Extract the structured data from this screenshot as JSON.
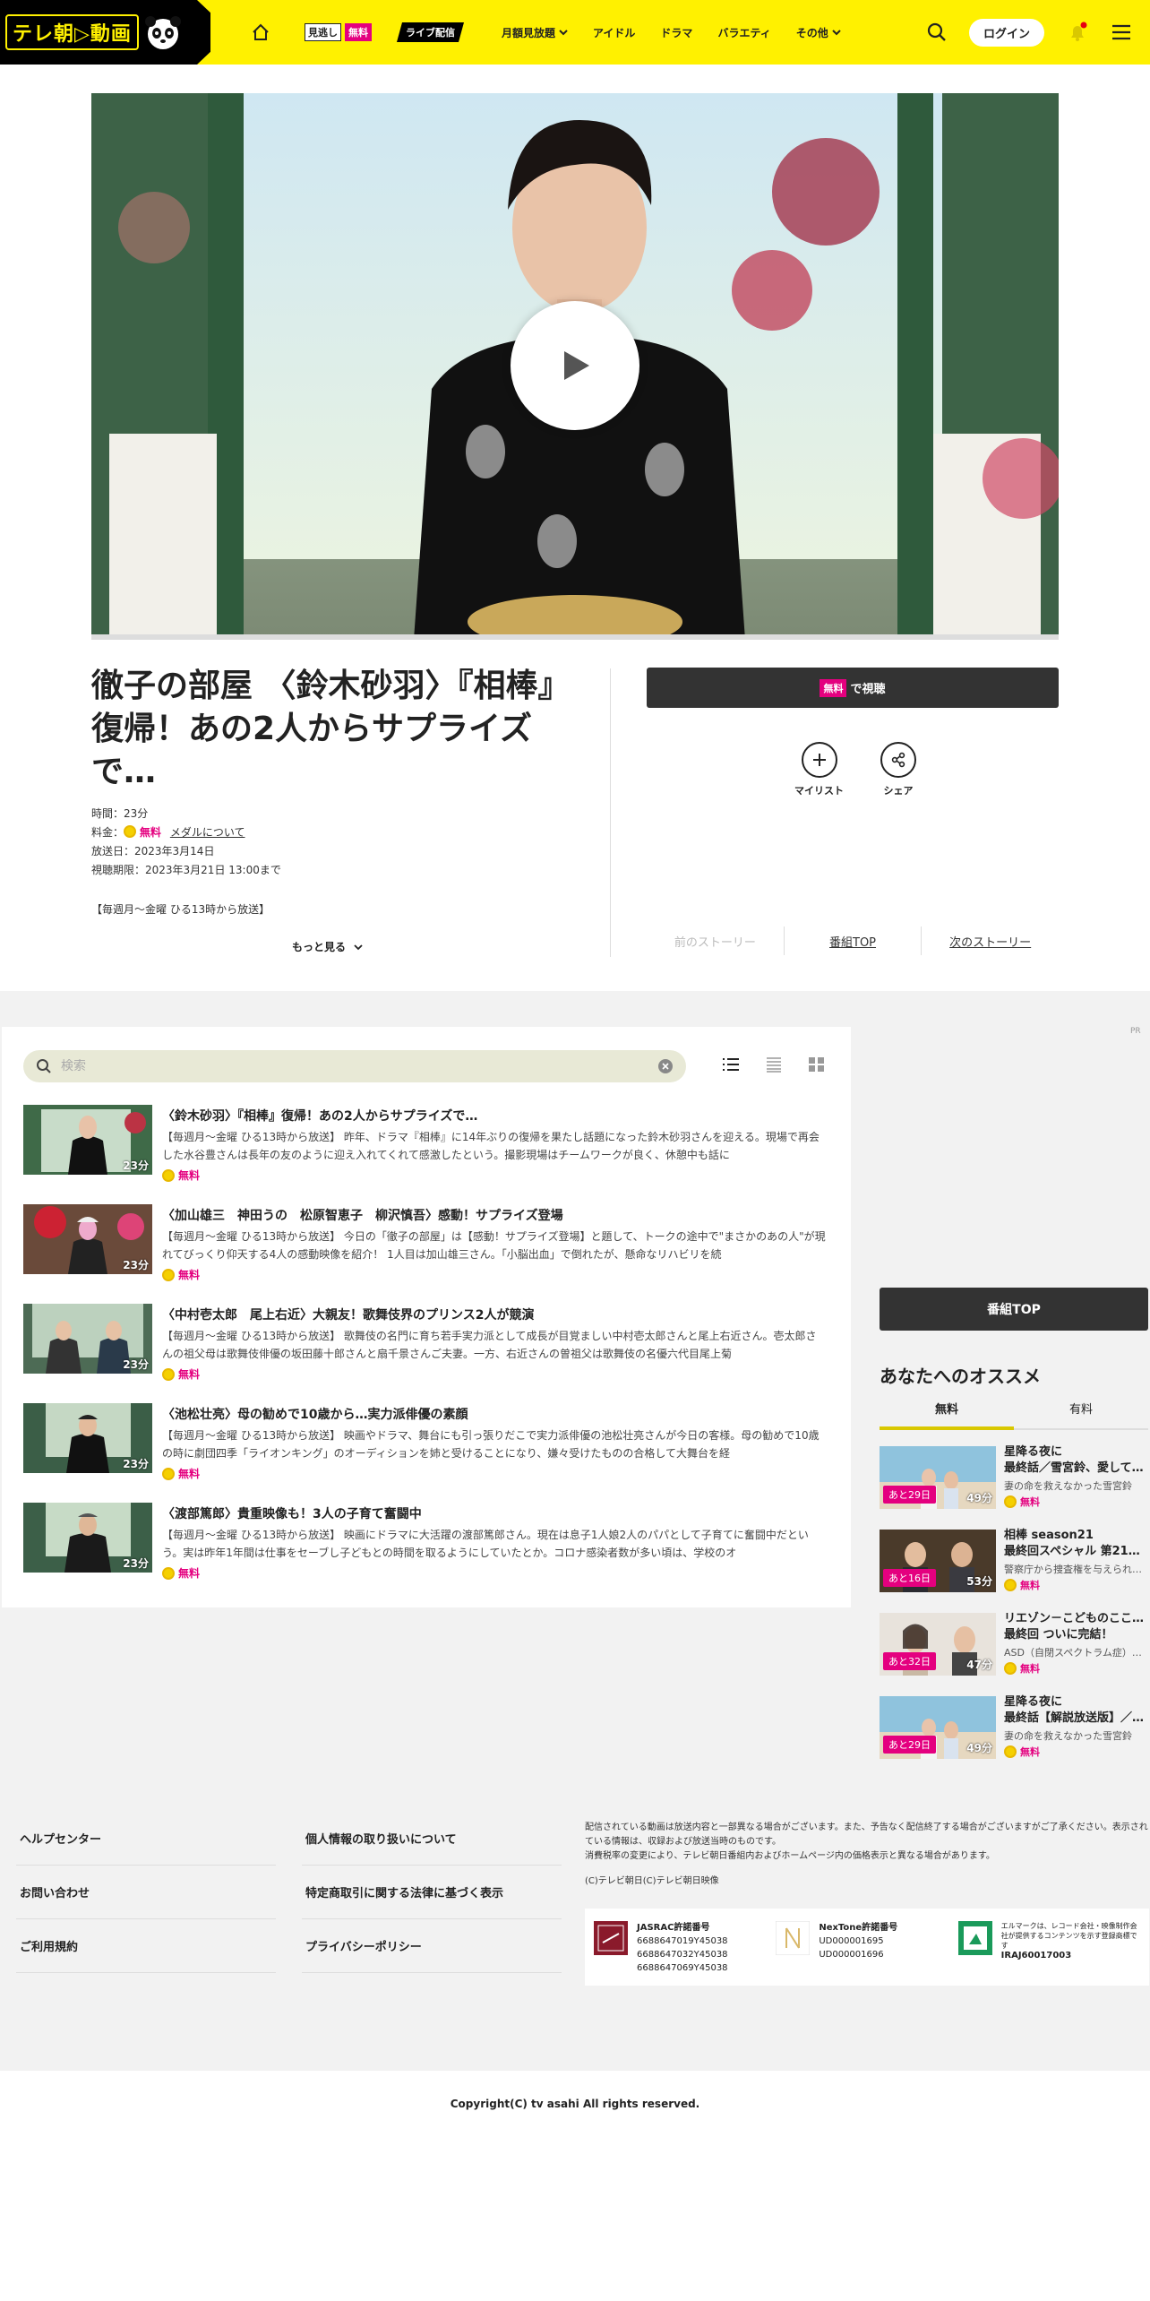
{
  "header": {
    "logo_text": "テレ朝▷動画",
    "nav": [
      {
        "label": "見逃し",
        "badge": "無料"
      },
      {
        "label": "ライブ配信"
      },
      {
        "label": "月額見放題"
      },
      {
        "label": "アイドル"
      },
      {
        "label": "ドラマ"
      },
      {
        "label": "バラエティ"
      },
      {
        "label": "その他"
      }
    ],
    "login_label": "ログイン"
  },
  "program": {
    "title": "徹子の部屋 〈鈴木砂羽〉『相棒』復帰！あの2人からサプライズで…",
    "duration": "時間：23分",
    "price_label": "料金：",
    "price": "無料",
    "medal_link": "メダルについて",
    "broadcast": "放送日：2023年3月14日",
    "expiry": "視聴期限：2023年3月21日 13:00まで",
    "airtime": "【毎週月～金曜 ひる13時から放送】",
    "more_label": "もっと見る",
    "watch_badge": "無料",
    "watch_label": "で視聴",
    "mylist_label": "マイリスト",
    "share_label": "シェア",
    "prev_story": "前のストーリー",
    "program_top": "番組TOP",
    "next_story": "次のストーリー"
  },
  "episodes": {
    "search_placeholder": "検索",
    "items": [
      {
        "title": "〈鈴木砂羽〉『相棒』復帰！あの2人からサプライズで…",
        "desc": "【毎週月～金曜 ひる13時から放送】 昨年、ドラマ『相棒』に14年ぶりの復帰を果たし話題になった鈴木砂羽さんを迎える。現場で再会した水谷豊さんは長年の友のように迎え入れてくれて感激したという。撮影現場はチームワークが良く、休憩中も話に",
        "duration": "23分",
        "free": "無料"
      },
      {
        "title": "〈加山雄三　神田うの　松原智恵子　柳沢慎吾〉感動！サプライズ登場",
        "desc": "【毎週月～金曜 ひる13時から放送】 今日の「徹子の部屋」は【感動！サプライズ登場】と題して、トークの途中で\"まさかのあの人\"が現れてびっくり仰天する4人の感動映像を紹介！ 1人目は加山雄三さん。「小脳出血」で倒れたが、懸命なリハビリを続",
        "duration": "23分",
        "free": "無料"
      },
      {
        "title": "〈中村壱太郎　尾上右近〉大親友！歌舞伎界のプリンス2人が競演",
        "desc": "【毎週月～金曜 ひる13時から放送】 歌舞伎の名門に育ち若手実力派として成長が目覚ましい中村壱太郎さんと尾上右近さん。壱太郎さんの祖父母は歌舞伎俳優の坂田藤十郎さんと扇千景さんご夫妻。一方、右近さんの曽祖父は歌舞伎の名優六代目尾上菊",
        "duration": "23分",
        "free": "無料"
      },
      {
        "title": "〈池松壮亮〉母の勧めで10歳から…実力派俳優の素顔",
        "desc": "【毎週月～金曜 ひる13時から放送】 映画やドラマ、舞台にも引っ張りだこで実力派俳優の池松壮亮さんが今日の客様。母の勧めで10歳の時に劇団四季「ライオンキング」のオーディションを姉と受けることになり、嫌々受けたものの合格して大舞台を経",
        "duration": "23分",
        "free": "無料"
      },
      {
        "title": "〈渡部篤郎〉貴重映像も！3人の子育て奮闘中",
        "desc": "【毎週月～金曜 ひる13時から放送】 映画にドラマに大活躍の渡部篤郎さん。現在は息子1人娘2人のパパとして子育てに奮闘中だという。実は昨年1年間は仕事をセーブし子どもとの時間を取るようにしていたとか。コロナ感染者数が多い頃は、学校のオ",
        "duration": "23分",
        "free": "無料"
      }
    ]
  },
  "sidebar": {
    "pr": "PR",
    "program_top": "番組TOP",
    "rec_heading": "あなたへのオススメ",
    "tabs": [
      "無料",
      "有料"
    ],
    "items": [
      {
        "title": "星降る夜に\n最終話／雪宮鈴、愛して…",
        "desc": "妻の命を救えなかった雪宮鈴",
        "left": "あと29日",
        "duration": "49分",
        "free": "無料"
      },
      {
        "title": "相棒 season21\n最終回スペシャル 第21…",
        "desc": "警察庁から捜査権を与えられ…",
        "left": "あと16日",
        "duration": "53分",
        "free": "無料"
      },
      {
        "title": "リエゾン－こどものここ…\n最終回 ついに完結！「こ…",
        "desc": "ASD（自閉スペクトラム症）…",
        "left": "あと32日",
        "duration": "47分",
        "free": "無料"
      },
      {
        "title": "星降る夜に\n最終話【解説放送版】／…",
        "desc": "妻の命を救えなかった雪宮鈴",
        "left": "あと29日",
        "duration": "49分",
        "free": "無料"
      }
    ]
  },
  "footer": {
    "links_col1": [
      "ヘルプセンター",
      "お問い合わせ",
      "ご利用規約"
    ],
    "links_col2": [
      "個人情報の取り扱いについて",
      "特定商取引に関する法律に基づく表示",
      "プライバシーポリシー"
    ],
    "note1": "配信されている動画は放送内容と一部異なる場合がございます。また、予告なく配信終了する場合がございますがご了承ください。表示されている情報は、収録および放送当時のものです。",
    "note2": "消費税率の変更により、テレビ朝日番組内およびホームページ内の価格表示と異なる場合があります。",
    "note3": "(C)テレビ朝日(C)テレビ朝日映像",
    "jasrac_label": "JASRAC許諾番号",
    "jasrac_nums": [
      "6688647019Y45038",
      "6688647032Y45038",
      "6688647069Y45038"
    ],
    "nextone_label": "NexTone許諾番号",
    "nextone_nums": [
      "UD000001695",
      "UD000001696"
    ],
    "lmark_text": "エルマークは、レコード会社・映像制作会社が提供するコンテンツを示す登録商標です",
    "lmark_num": "IRAJ60017003",
    "copyright": "Copyright(C) tv asahi All rights reserved."
  },
  "colors": {
    "brand_yellow": "#fff100",
    "free_pink": "#e4007f",
    "dark_button": "#333333"
  }
}
